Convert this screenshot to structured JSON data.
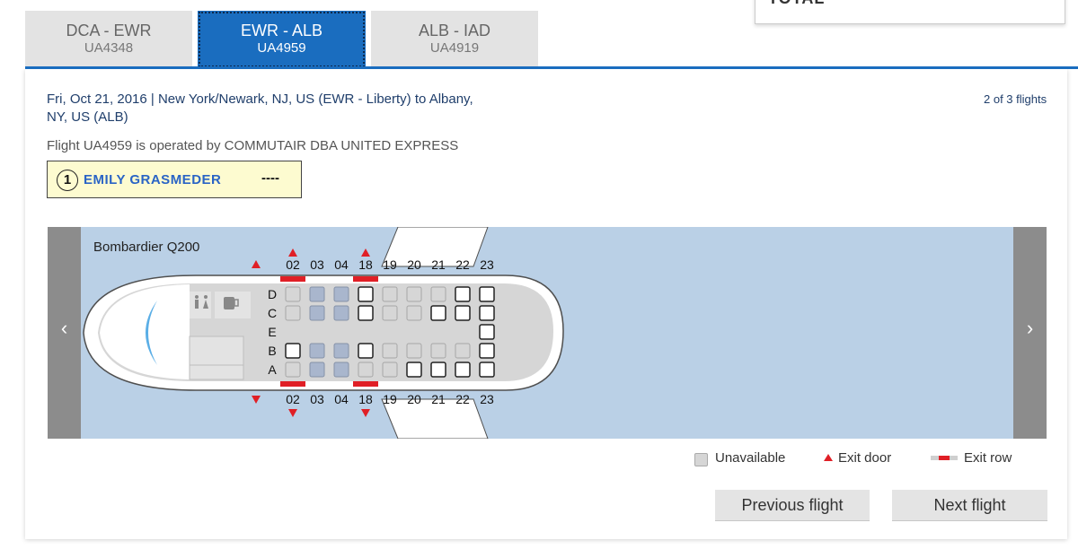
{
  "tabs": [
    {
      "route": "DCA - EWR",
      "flight": "UA4348"
    },
    {
      "route": "EWR - ALB",
      "flight": "UA4959"
    },
    {
      "route": "ALB - IAD",
      "flight": "UA4919"
    }
  ],
  "total_label": "TOTAL",
  "flight_info": {
    "route_line_1": "Fri, Oct 21, 2016 | New York/Newark, NJ, US (EWR - Liberty) to Albany,",
    "route_line_2": "NY, US (ALB)",
    "count": "2 of 3 flights",
    "operated_by": "Flight UA4959 is operated by COMMUTAIR DBA UNITED EXPRESS"
  },
  "passenger": {
    "number": "1",
    "name": "EMILY GRASMEDER",
    "seat": "----"
  },
  "seat_map": {
    "aircraft": "Bombardier Q200",
    "rows": [
      "02",
      "03",
      "04",
      "18",
      "19",
      "20",
      "21",
      "22",
      "23"
    ],
    "letters": [
      "D",
      "C",
      "E",
      "B",
      "A"
    ],
    "prev_icon": "chevron-left-icon",
    "next_icon": "chevron-right-icon"
  },
  "legend": {
    "unavailable": "Unavailable",
    "exit_door": "Exit door",
    "exit_row": "Exit row"
  },
  "buttons": {
    "previous": "Previous flight",
    "next": "Next flight"
  },
  "colors": {
    "accent": "#1a6dbf",
    "exit": "#e01f26",
    "map_bg": "#bad0e6",
    "passenger_name": "#2a64c5"
  }
}
